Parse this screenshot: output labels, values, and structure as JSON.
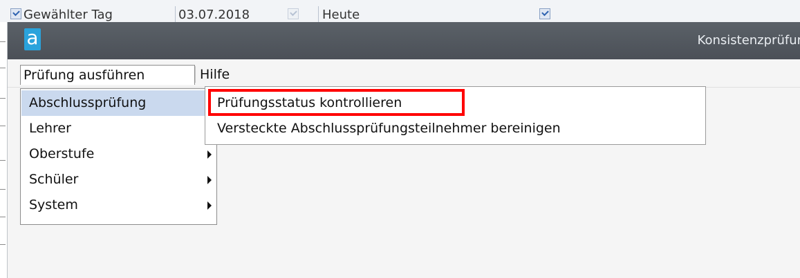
{
  "background_toolbar": {
    "day_label": "Gewählter Tag",
    "date_value": "03.07.2018",
    "today_label": "Heute"
  },
  "window": {
    "logo_letter": "a",
    "title": "Konsistenzprüfur"
  },
  "menubar": {
    "items": [
      {
        "label": "Prüfung ausführen"
      },
      {
        "label": "Hilfe"
      }
    ]
  },
  "dropdown": {
    "items": [
      {
        "label": "Abschlussprüfung",
        "has_submenu": true,
        "active": true
      },
      {
        "label": "Lehrer",
        "has_submenu": true
      },
      {
        "label": "Oberstufe",
        "has_submenu": true
      },
      {
        "label": "Schüler",
        "has_submenu": true
      },
      {
        "label": "System",
        "has_submenu": true
      }
    ]
  },
  "submenu": {
    "items": [
      {
        "label": "Prüfungsstatus kontrollieren",
        "highlighted": true
      },
      {
        "label": "Versteckte Abschlussprüfungsteilnehmer bereinigen"
      }
    ]
  },
  "colors": {
    "titlebar": "#50565d",
    "logo": "#2aa3dc",
    "active_item": "#cad9ee",
    "annotation_red": "#ff0000"
  }
}
